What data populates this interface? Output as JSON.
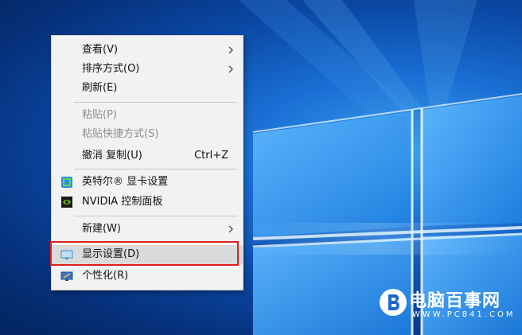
{
  "context_menu": {
    "items": [
      {
        "label": "查看(V)",
        "has_submenu": true,
        "enabled": true
      },
      {
        "label": "排序方式(O)",
        "has_submenu": true,
        "enabled": true
      },
      {
        "label": "刷新(E)",
        "has_submenu": false,
        "enabled": true
      },
      {
        "label": "粘贴(P)",
        "has_submenu": false,
        "enabled": false
      },
      {
        "label": "粘贴快捷方式(S)",
        "has_submenu": false,
        "enabled": false
      },
      {
        "label": "撤消 复制(U)",
        "shortcut": "Ctrl+Z",
        "has_submenu": false,
        "enabled": true
      },
      {
        "label": "英特尔® 显卡设置",
        "icon": "intel-graphics-icon",
        "has_submenu": false,
        "enabled": true
      },
      {
        "label": "NVIDIA 控制面板",
        "icon": "nvidia-icon",
        "has_submenu": false,
        "enabled": true
      },
      {
        "label": "新建(W)",
        "has_submenu": true,
        "enabled": true
      },
      {
        "label": "显示设置(D)",
        "icon": "display-settings-icon",
        "has_submenu": false,
        "enabled": true,
        "highlighted": true
      },
      {
        "label": "个性化(R)",
        "icon": "personalize-icon",
        "has_submenu": false,
        "enabled": true
      }
    ]
  },
  "highlight_color": "#e01e1e",
  "watermark": {
    "name": "电脑百事网",
    "url": "WWW.PC841.COM"
  }
}
